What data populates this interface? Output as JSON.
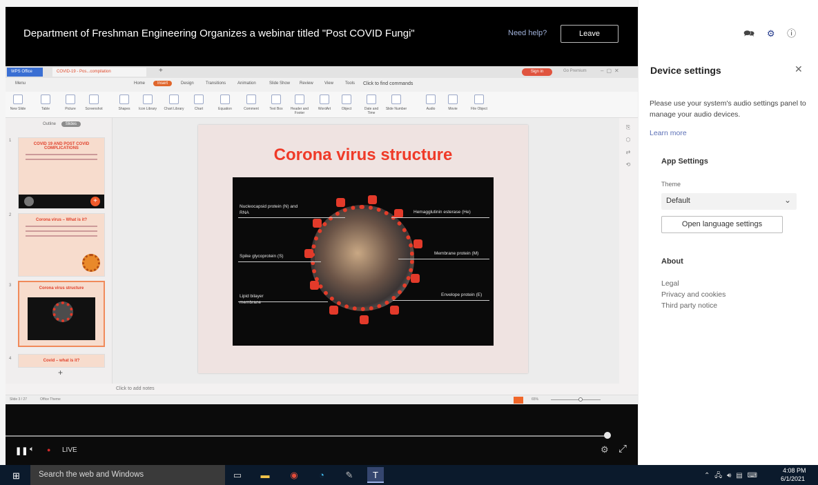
{
  "meeting": {
    "title": "Department of Freshman Engineering Organizes a webinar titled \"Post COVID Fungi\"",
    "need_help": "Need help?",
    "leave": "Leave"
  },
  "presentation": {
    "tabs": {
      "wps": "WPS Office",
      "document": "COVID-19 - Pos...compilation"
    },
    "sign_in": "Sign in",
    "go_premium": "Go Premium",
    "menu": [
      "Menu",
      "Home",
      "Insert",
      "Design",
      "Transitions",
      "Animation",
      "Slide Show",
      "Review",
      "View",
      "Tools"
    ],
    "find_commands": "Click to find commands",
    "ribbon": [
      "New Slide",
      "Table",
      "Picture",
      "Screenshot",
      "Shapes",
      "Icon Library",
      "Chart Library",
      "Chart",
      "Equation",
      "Comment",
      "Text Box",
      "Header and Footer",
      "WordArt",
      "Object",
      "Date and Time",
      "Slide Number",
      "Audio",
      "Movie",
      "File Object"
    ],
    "thumb_tabs": {
      "outline": "Outline",
      "slides": "Slides"
    },
    "thumbs": [
      {
        "num": "1",
        "title": "COVID 19 AND POST COVID COMPLICATIONS"
      },
      {
        "num": "2",
        "title": "Corona virus – What is it?"
      },
      {
        "num": "3",
        "title": "Corona virus structure"
      },
      {
        "num": "4",
        "title": "Covid – what is it?"
      }
    ],
    "slide": {
      "title": "Corona virus structure",
      "labels": {
        "nucleocapsid": "Nucleocapsid protein (N) and RNA",
        "spike": "Spike glycoprotein (S)",
        "lipid": "Lipid bilayer membrane",
        "hemagglutinin": "Hemagglutinin esterase (He)",
        "membrane": "Membrane protein (M)",
        "envelope": "Envelope protein (E)"
      }
    },
    "notes": "Click to add notes",
    "status": {
      "slide_count": "Slide 3 / 27",
      "theme": "Office Theme",
      "zoom": "65%"
    }
  },
  "player": {
    "live": "LIVE",
    "progress": 0.995
  },
  "panel": {
    "title": "Device settings",
    "description": "Please use your system's audio settings panel to manage your audio devices.",
    "learn_more": "Learn more",
    "app_settings": "App Settings",
    "theme_label": "Theme",
    "theme_value": "Default",
    "language_button": "Open language settings",
    "about": "About",
    "about_links": [
      "Legal",
      "Privacy and cookies",
      "Third party notice"
    ]
  },
  "taskbar": {
    "search_placeholder": "Search the web and Windows",
    "time": "4:08 PM",
    "date": "6/1/2021"
  },
  "colors": {
    "accent": "#243a8c",
    "slide_title": "#ef3a28",
    "live": "#d02a2a",
    "insert_tab": "#e0662c"
  }
}
